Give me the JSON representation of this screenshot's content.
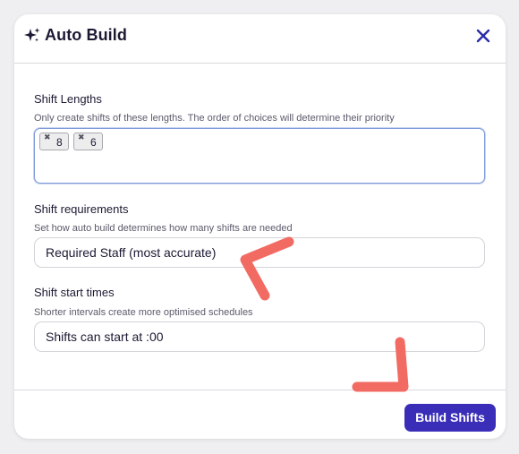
{
  "dialog": {
    "title": "Auto Build",
    "title_icon": "sparkle-icon",
    "close_icon": "close-icon"
  },
  "shift_lengths": {
    "label": "Shift Lengths",
    "help": "Only create shifts of these lengths. The order of choices will determine their priority",
    "chips": [
      {
        "value": "8",
        "remove_icon": "close-icon"
      },
      {
        "value": "6",
        "remove_icon": "close-icon"
      }
    ]
  },
  "shift_requirements": {
    "label": "Shift requirements",
    "help": "Set how auto build determines how many shifts are needed",
    "selected": "Required Staff (most accurate)"
  },
  "shift_start_times": {
    "label": "Shift start times",
    "help": "Shorter intervals create more optimised schedules",
    "selected": "Shifts can start at :00"
  },
  "footer": {
    "build_button": "Build Shifts"
  },
  "colors": {
    "accent": "#3a2db8",
    "annotation": "#f26b63",
    "focus_border": "#7f9bd9"
  }
}
